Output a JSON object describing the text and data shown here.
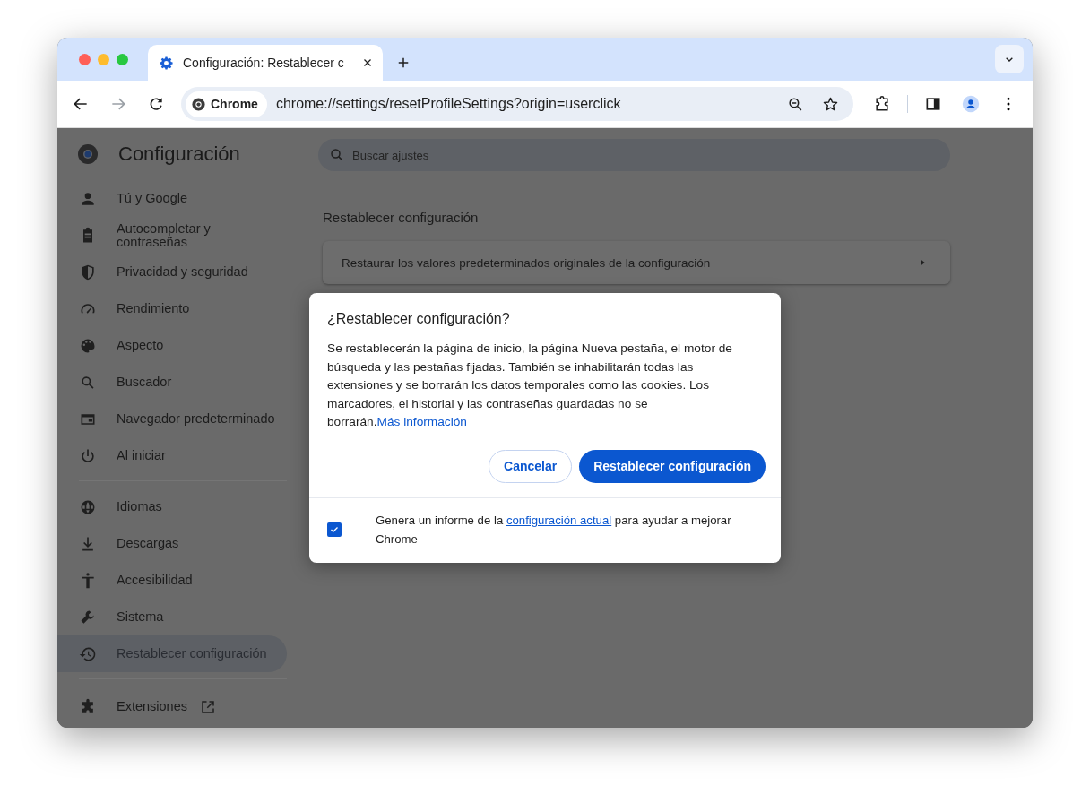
{
  "tabs": [
    {
      "title": "Configuración: Restablecer c",
      "selected": true
    }
  ],
  "toolbar": {
    "site_chip": "Chrome",
    "address": "chrome://settings/resetProfileSettings?origin=userclick"
  },
  "settings": {
    "title": "Configuración",
    "search": {
      "placeholder": "Buscar ajustes"
    },
    "sidebar": {
      "groups": [
        {
          "items": [
            {
              "label": "Tú y Google",
              "selected": false,
              "external": false
            },
            {
              "label": "Autocompletar y contraseñas",
              "selected": false,
              "external": false
            },
            {
              "label": "Privacidad y seguridad",
              "selected": false,
              "external": false
            },
            {
              "label": "Rendimiento",
              "selected": false,
              "external": false
            },
            {
              "label": "Aspecto",
              "selected": false,
              "external": false
            },
            {
              "label": "Buscador",
              "selected": false,
              "external": false
            },
            {
              "label": "Navegador predeterminado",
              "selected": false,
              "external": false
            },
            {
              "label": "Al iniciar",
              "selected": false,
              "external": false
            }
          ]
        },
        {
          "items": [
            {
              "label": "Idiomas",
              "selected": false,
              "external": false
            },
            {
              "label": "Descargas",
              "selected": false,
              "external": false
            },
            {
              "label": "Accesibilidad",
              "selected": false,
              "external": false
            },
            {
              "label": "Sistema",
              "selected": false,
              "external": false
            },
            {
              "label": "Restablecer configuración",
              "selected": true,
              "external": false
            }
          ]
        },
        {
          "items": [
            {
              "label": "Extensiones",
              "selected": false,
              "external": true
            }
          ]
        }
      ]
    },
    "section_title": "Restablecer configuración",
    "rows": [
      {
        "label": "Restaurar los valores predeterminados originales de la configuración"
      }
    ]
  },
  "dialog": {
    "title": "¿Restablecer configuración?",
    "body": "Se restablecerán la página de inicio, la página Nueva pestaña, el motor de búsqueda y las pestañas fijadas. También se inhabilitarán todas las extensiones y se borrarán los datos temporales como las cookies. Los marcadores, el historial y las contraseñas guardadas no se borrarán.",
    "link": "Más información",
    "buttons": [
      {
        "label": "Cancelar",
        "kind": "secondary"
      },
      {
        "label": "Restablecer configuración",
        "kind": "primary"
      }
    ],
    "report": {
      "checked": true,
      "text_before": "Genera un informe de la ",
      "link": "configuración actual",
      "text_after": " para ayudar a mejorar Chrome"
    }
  }
}
